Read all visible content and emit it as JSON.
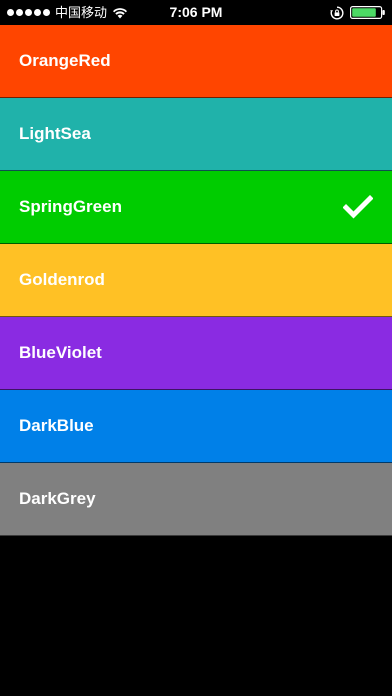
{
  "status_bar": {
    "carrier": "中国移动",
    "time": "7:06 PM",
    "signal_bars": 5,
    "battery_level": 0.85,
    "icons": {
      "wifi": "wifi-icon",
      "rotation_lock": "rotation-lock-icon",
      "battery": "battery-icon"
    }
  },
  "colors": [
    {
      "label": "OrangeRed",
      "color": "#FF4500",
      "selected": false
    },
    {
      "label": "LightSea",
      "color": "#20B2AA",
      "selected": false
    },
    {
      "label": "SpringGreen",
      "color": "#00CC00",
      "selected": true
    },
    {
      "label": "Goldenrod",
      "color": "#FFC125",
      "selected": false
    },
    {
      "label": "BlueViolet",
      "color": "#8A2BE2",
      "selected": false
    },
    {
      "label": "DarkBlue",
      "color": "#0080E8",
      "selected": false
    },
    {
      "label": "DarkGrey",
      "color": "#808080",
      "selected": false
    }
  ],
  "background": "#000000",
  "check_icon": "checkmark-icon"
}
